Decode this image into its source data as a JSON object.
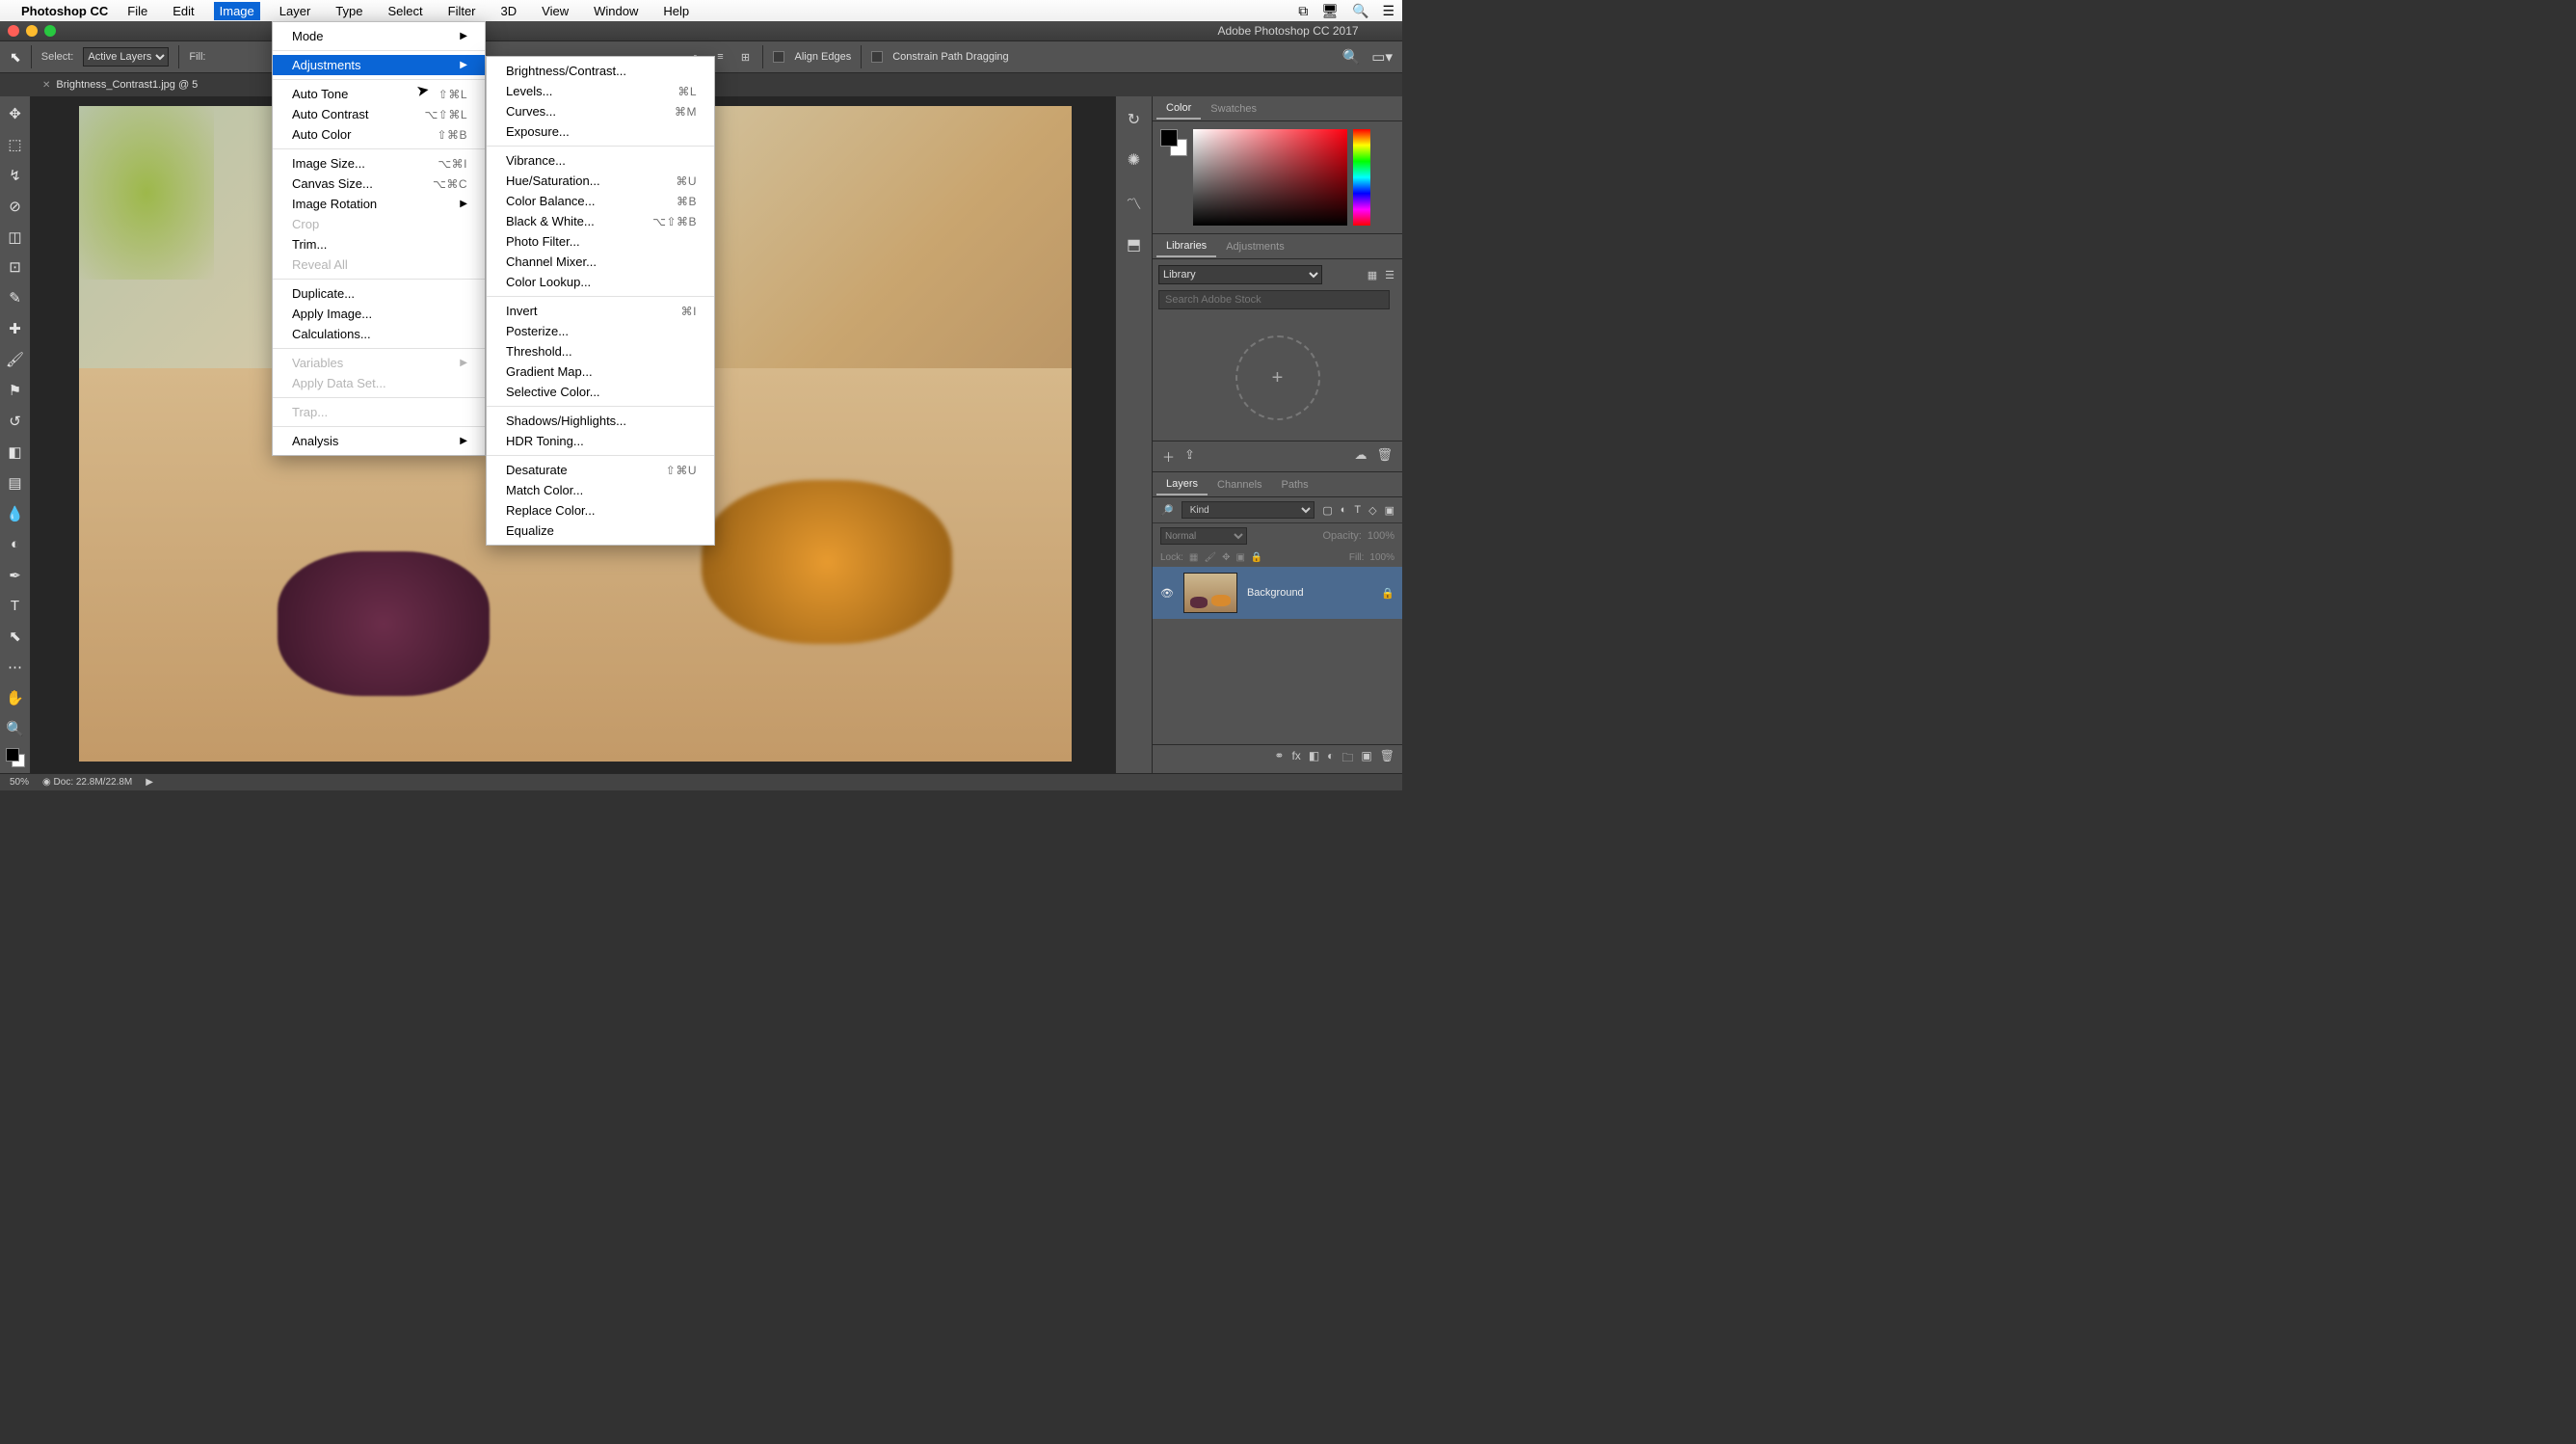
{
  "menubar": {
    "app": "Photoshop CC",
    "items": [
      "File",
      "Edit",
      "Image",
      "Layer",
      "Type",
      "Select",
      "Filter",
      "3D",
      "View",
      "Window",
      "Help"
    ],
    "active": "Image"
  },
  "window": {
    "title": "Adobe Photoshop CC 2017"
  },
  "options": {
    "select_label": "Select:",
    "select_value": "Active Layers",
    "fill_label": "Fill:",
    "align_edges": "Align Edges",
    "constrain": "Constrain Path Dragging"
  },
  "doc_tab": {
    "name": "Brightness_Contrast1.jpg @ 5"
  },
  "image_menu": [
    {
      "label": "Mode",
      "arrow": true
    },
    {
      "sep": true
    },
    {
      "label": "Adjustments",
      "arrow": true,
      "highlight": true
    },
    {
      "sep": true
    },
    {
      "label": "Auto Tone",
      "shortcut": "⇧⌘L"
    },
    {
      "label": "Auto Contrast",
      "shortcut": "⌥⇧⌘L"
    },
    {
      "label": "Auto Color",
      "shortcut": "⇧⌘B"
    },
    {
      "sep": true
    },
    {
      "label": "Image Size...",
      "shortcut": "⌥⌘I"
    },
    {
      "label": "Canvas Size...",
      "shortcut": "⌥⌘C"
    },
    {
      "label": "Image Rotation",
      "arrow": true
    },
    {
      "label": "Crop",
      "disabled": true
    },
    {
      "label": "Trim..."
    },
    {
      "label": "Reveal All",
      "disabled": true
    },
    {
      "sep": true
    },
    {
      "label": "Duplicate..."
    },
    {
      "label": "Apply Image..."
    },
    {
      "label": "Calculations..."
    },
    {
      "sep": true
    },
    {
      "label": "Variables",
      "arrow": true,
      "disabled": true
    },
    {
      "label": "Apply Data Set...",
      "disabled": true
    },
    {
      "sep": true
    },
    {
      "label": "Trap...",
      "disabled": true
    },
    {
      "sep": true
    },
    {
      "label": "Analysis",
      "arrow": true
    }
  ],
  "adjust_menu": [
    {
      "label": "Brightness/Contrast..."
    },
    {
      "label": "Levels...",
      "shortcut": "⌘L"
    },
    {
      "label": "Curves...",
      "shortcut": "⌘M"
    },
    {
      "label": "Exposure..."
    },
    {
      "sep": true
    },
    {
      "label": "Vibrance..."
    },
    {
      "label": "Hue/Saturation...",
      "shortcut": "⌘U"
    },
    {
      "label": "Color Balance...",
      "shortcut": "⌘B"
    },
    {
      "label": "Black & White...",
      "shortcut": "⌥⇧⌘B"
    },
    {
      "label": "Photo Filter..."
    },
    {
      "label": "Channel Mixer..."
    },
    {
      "label": "Color Lookup..."
    },
    {
      "sep": true
    },
    {
      "label": "Invert",
      "shortcut": "⌘I"
    },
    {
      "label": "Posterize..."
    },
    {
      "label": "Threshold..."
    },
    {
      "label": "Gradient Map..."
    },
    {
      "label": "Selective Color..."
    },
    {
      "sep": true
    },
    {
      "label": "Shadows/Highlights..."
    },
    {
      "label": "HDR Toning..."
    },
    {
      "sep": true
    },
    {
      "label": "Desaturate",
      "shortcut": "⇧⌘U"
    },
    {
      "label": "Match Color..."
    },
    {
      "label": "Replace Color..."
    },
    {
      "label": "Equalize"
    }
  ],
  "panels": {
    "color_tab": "Color",
    "swatches_tab": "Swatches",
    "libraries_tab": "Libraries",
    "adjustments_tab": "Adjustments",
    "library_select": "Library",
    "search_placeholder": "Search Adobe Stock",
    "layers_tab": "Layers",
    "channels_tab": "Channels",
    "paths_tab": "Paths",
    "kind_label": "Kind",
    "blend_mode": "Normal",
    "opacity_label": "Opacity:",
    "opacity_value": "100%",
    "lock_label": "Lock:",
    "fill_label": "Fill:",
    "fill_value": "100%",
    "layer_name": "Background"
  },
  "status": {
    "zoom": "50%",
    "doc_info": "Doc: 22.8M/22.8M"
  }
}
